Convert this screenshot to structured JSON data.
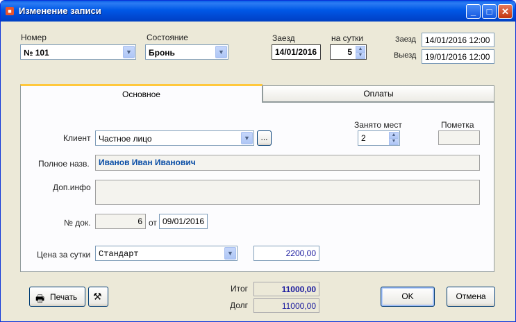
{
  "window": {
    "title": "Изменение записи",
    "icon": "app-icon"
  },
  "header": {
    "room_label": "Номер",
    "room_value": "№ 101",
    "state_label": "Состояние",
    "state_value": "Бронь",
    "checkin_label": "Заезд",
    "checkin_date": "14/01/2016",
    "nights_label": "на сутки",
    "nights_value": "5",
    "checkin_full_label": "Заезд",
    "checkin_full_value": "14/01/2016 12:00",
    "checkout_label": "Выезд",
    "checkout_value": "19/01/2016 12:00"
  },
  "tabs": [
    {
      "label": "Основное"
    },
    {
      "label": "Оплаты"
    }
  ],
  "main": {
    "client_label": "Клиент",
    "client_value": "Частное лицо",
    "browse_label": "...",
    "seats_label": "Занято мест",
    "seats_value": "2",
    "mark_label": "Пометка",
    "mark_value": "",
    "fullname_label": "Полное назв.",
    "fullname_value": "Иванов Иван Иванович",
    "info_label": "Доп.инфо",
    "info_value": "",
    "doc_label": "№ док.",
    "doc_value": "6",
    "doc_from_label": "от",
    "doc_date": "09/01/2016",
    "price_label": "Цена за сутки",
    "price_type": "Стандарт",
    "price_value": "2200,00"
  },
  "footer": {
    "print_label": "Печать",
    "total_label": "Итог",
    "total_value": "11000,00",
    "debt_label": "Долг",
    "debt_value": "11000,00",
    "ok_label": "OK",
    "cancel_label": "Отмена"
  }
}
